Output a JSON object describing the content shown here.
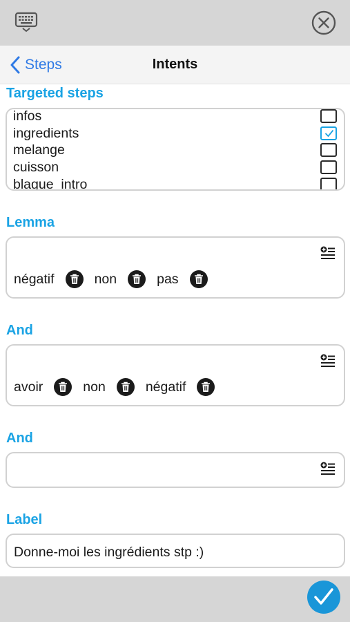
{
  "top_bar": {
    "keyboard_icon": "keyboard-icon",
    "close_icon": "close-circle-icon"
  },
  "nav": {
    "back_label": "Steps",
    "title": "Intents"
  },
  "targeted_steps": {
    "label": "Targeted steps",
    "items": [
      {
        "label": "infos",
        "checked": false
      },
      {
        "label": "ingredients",
        "checked": true
      },
      {
        "label": "melange",
        "checked": false
      },
      {
        "label": "cuisson",
        "checked": false
      },
      {
        "label": "blague_intro",
        "checked": false
      }
    ]
  },
  "lemma": {
    "label": "Lemma",
    "terms": [
      "négatif",
      "non",
      "pas"
    ]
  },
  "and_1": {
    "label": "And",
    "terms": [
      "avoir",
      "non",
      "négatif"
    ]
  },
  "and_2": {
    "label": "And",
    "terms": []
  },
  "label_field": {
    "label": "Label",
    "value": "Donne-moi les ingrédients stp :)"
  },
  "colors": {
    "accent": "#1aa3e4",
    "link": "#2f7ae5",
    "confirm": "#1a96d8"
  }
}
